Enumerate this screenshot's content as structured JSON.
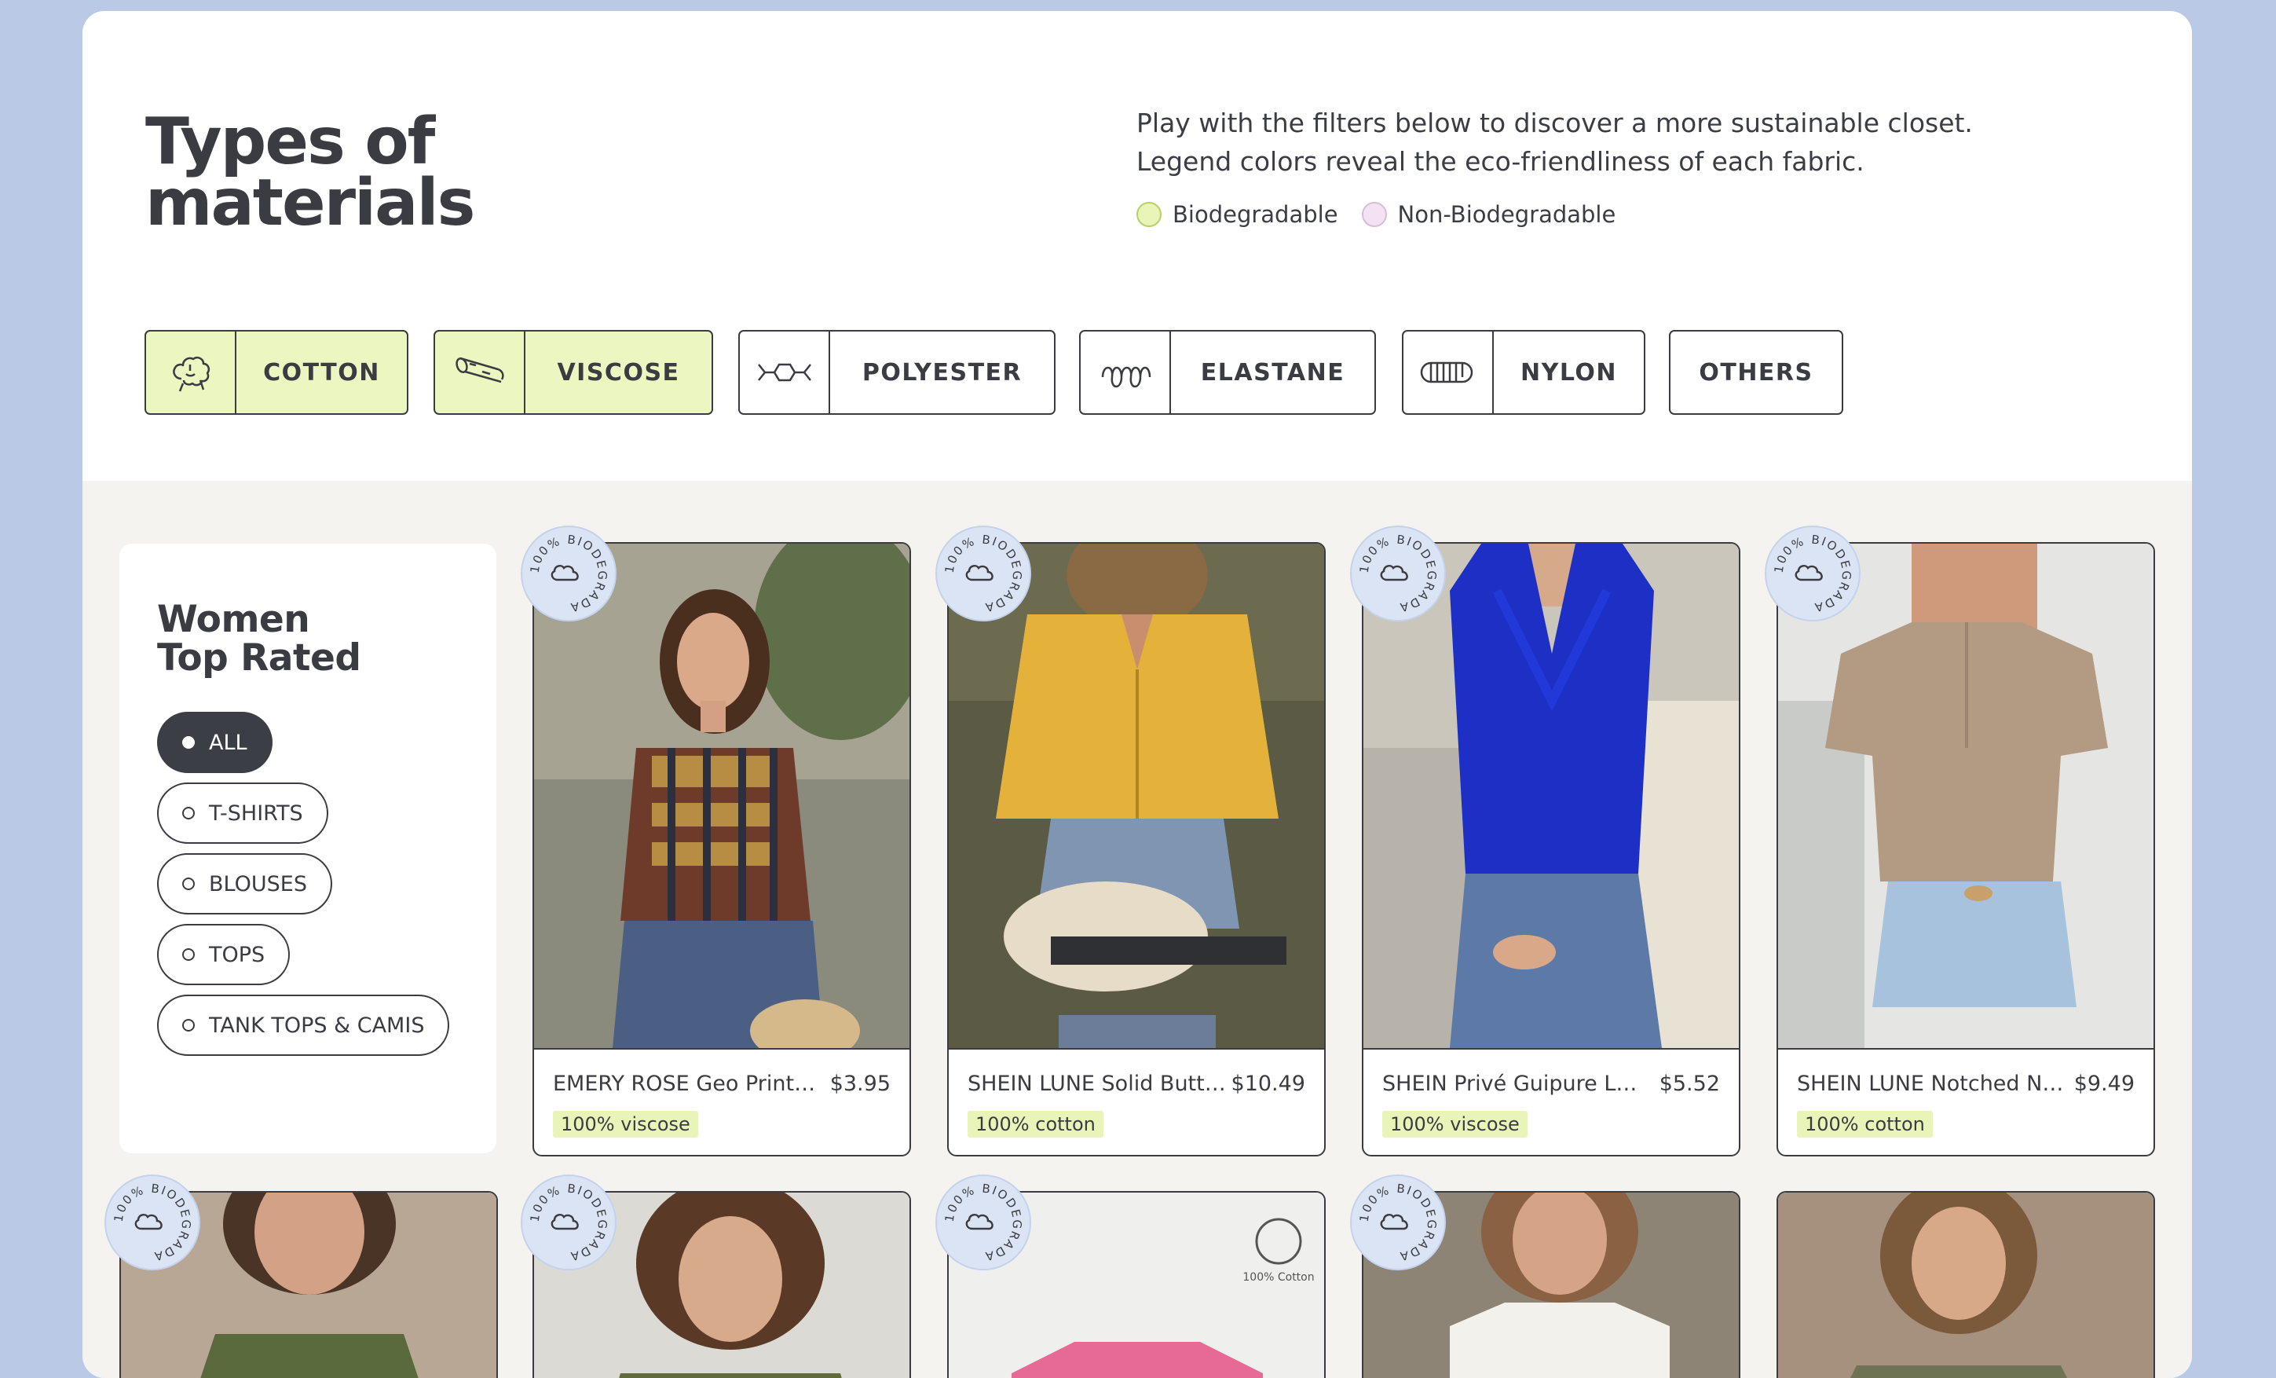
{
  "header": {
    "title_line1": "Types of",
    "title_line2": "materials",
    "intro_line1": "Play with the filters below to discover a more sustainable closet.",
    "intro_line2": "Legend colors reveal the eco-friendliness of each fabric.",
    "legend": [
      {
        "label": "Biodegradable",
        "color": "#e8f4b8"
      },
      {
        "label": "Non-Biodegradable",
        "color": "#f2e2f2"
      }
    ]
  },
  "filters": [
    {
      "label": "COTTON",
      "icon": "cotton-flower-icon",
      "active": true
    },
    {
      "label": "VISCOSE",
      "icon": "wood-log-icon",
      "active": true
    },
    {
      "label": "POLYESTER",
      "icon": "polymer-chain-icon",
      "active": false
    },
    {
      "label": "ELASTANE",
      "icon": "spring-coil-icon",
      "active": false
    },
    {
      "label": "NYLON",
      "icon": "fiber-strand-icon",
      "active": false
    },
    {
      "label": "OTHERS",
      "icon": "",
      "active": false
    }
  ],
  "sidebar": {
    "title_line1": "Women",
    "title_line2": "Top Rated",
    "categories": [
      {
        "label": "ALL",
        "active": true
      },
      {
        "label": "T-SHIRTS",
        "active": false
      },
      {
        "label": "BLOUSES",
        "active": false
      },
      {
        "label": "TOPS",
        "active": false
      },
      {
        "label": "TANK TOPS & CAMIS",
        "active": false
      }
    ]
  },
  "badge": {
    "text": "100% BIODEGRADABLE"
  },
  "products": [
    {
      "name": "EMERY ROSE Geo Print B...",
      "price": "$3.95",
      "material": "100% viscose"
    },
    {
      "name": "SHEIN LUNE Solid Butto...",
      "price": "$10.49",
      "material": "100% cotton"
    },
    {
      "name": "SHEIN Privé Guipure Lac...",
      "price": "$5.52",
      "material": "100% viscose"
    },
    {
      "name": "SHEIN LUNE Notched Ne...",
      "price": "$9.49",
      "material": "100% cotton"
    }
  ],
  "row2_label": "100% Cotton",
  "colors": {
    "accent_bio": "#e8f4b8",
    "accent_non": "#f2e2f2",
    "ink": "#3a3c42",
    "page_bg": "#b9c9e6"
  }
}
